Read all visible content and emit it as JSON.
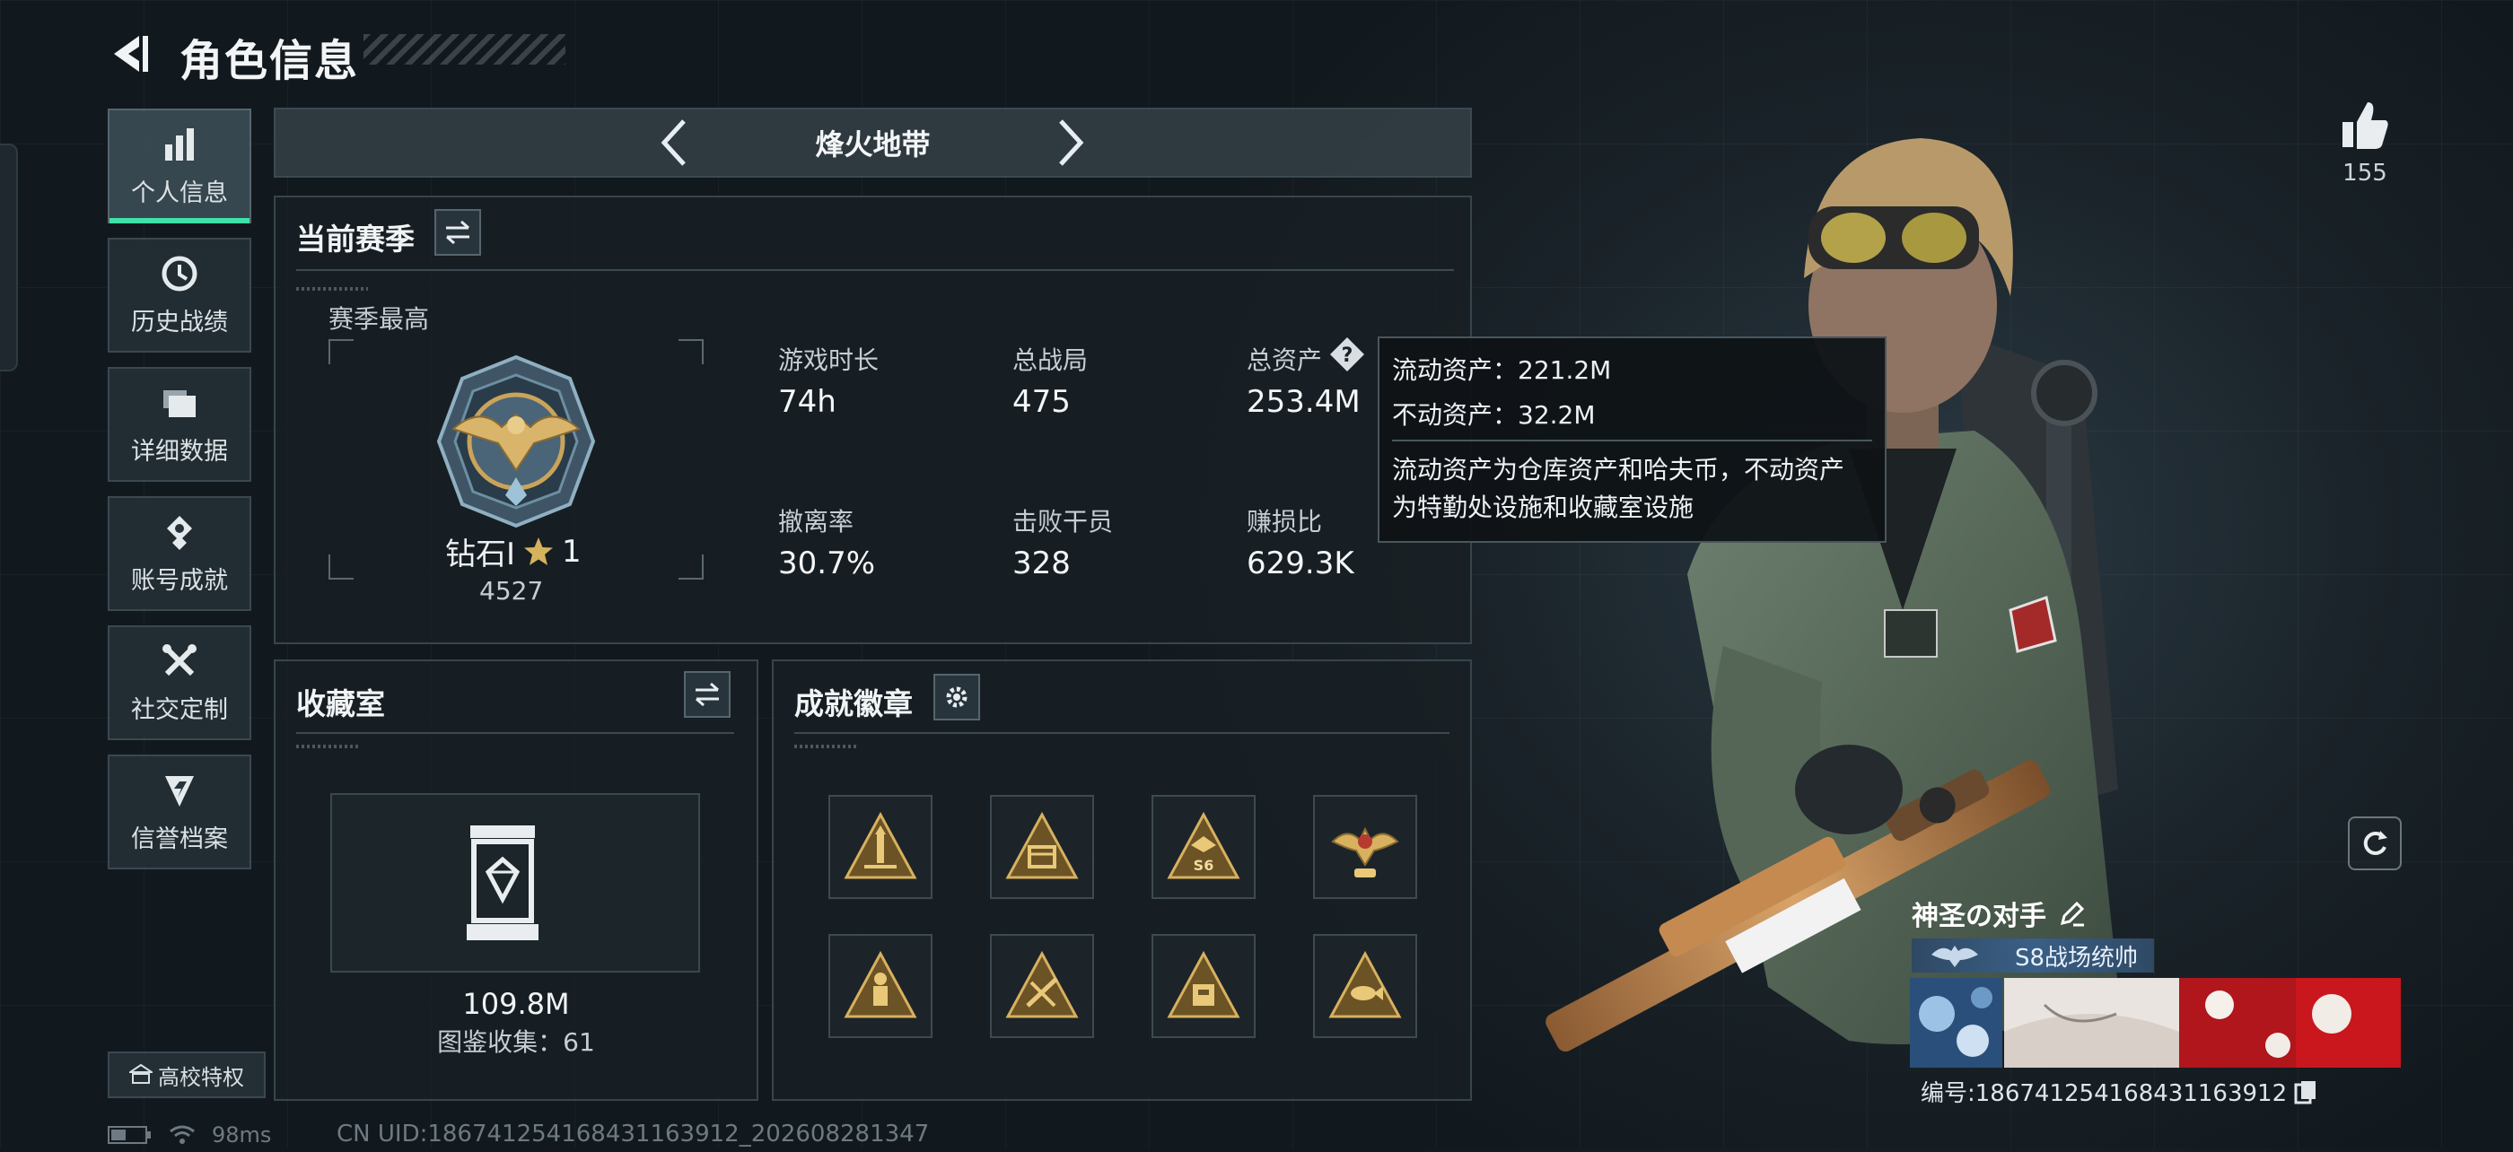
{
  "header": {
    "title": "角色信息"
  },
  "sidebar": {
    "items": [
      {
        "label": "个人信息",
        "icon": "bar-chart-icon",
        "active": true
      },
      {
        "label": "历史战绩",
        "icon": "history-icon"
      },
      {
        "label": "详细数据",
        "icon": "folder-icon"
      },
      {
        "label": "账号成就",
        "icon": "achievement-icon"
      },
      {
        "label": "社交定制",
        "icon": "tools-icon"
      },
      {
        "label": "信誉档案",
        "icon": "credit-icon"
      }
    ],
    "campus_label": "高校特权"
  },
  "mode": {
    "label": "烽火地带"
  },
  "season": {
    "title": "当前赛季",
    "best_label": "赛季最高",
    "rank_name": "钻石Ⅰ",
    "rank_star_count": "1",
    "rank_score": "4527",
    "stats": [
      {
        "label": "游戏时长",
        "value": "74h"
      },
      {
        "label": "总战局",
        "value": "475"
      },
      {
        "label": "总资产",
        "value": "253.4M"
      },
      {
        "label": "撤离率",
        "value": "30.7%"
      },
      {
        "label": "击败干员",
        "value": "328"
      },
      {
        "label": "赚损比",
        "value": "629.3K"
      }
    ]
  },
  "tooltip": {
    "liquid": "流动资产：221.2M",
    "fixed": "不动资产：32.2M",
    "desc_line1": "流动资产为仓库资产和哈夫币，不动资产",
    "desc_line2": "为特勤处设施和收藏室设施"
  },
  "collection": {
    "title": "收藏室",
    "value": "109.8M",
    "count_label": "图鉴收集：61"
  },
  "badges": {
    "title": "成就徽章",
    "items": [
      "badge-rocket",
      "badge-tent",
      "badge-s6",
      "badge-eagle",
      "badge-soldier",
      "badge-tools",
      "badge-vault",
      "badge-fish"
    ],
    "s6_text": "S6"
  },
  "profile": {
    "likes": "155",
    "name": "神圣の对手",
    "title": "S8战场统帅",
    "uid_label": "编号:186741254168431163912"
  },
  "status": {
    "ping": "98ms",
    "uid_full": "CN UID:186741254168431163912_202608281347"
  },
  "colors": {
    "accent": "#3fe2a8",
    "gold": "#c9a45a",
    "panel": "#182025"
  }
}
